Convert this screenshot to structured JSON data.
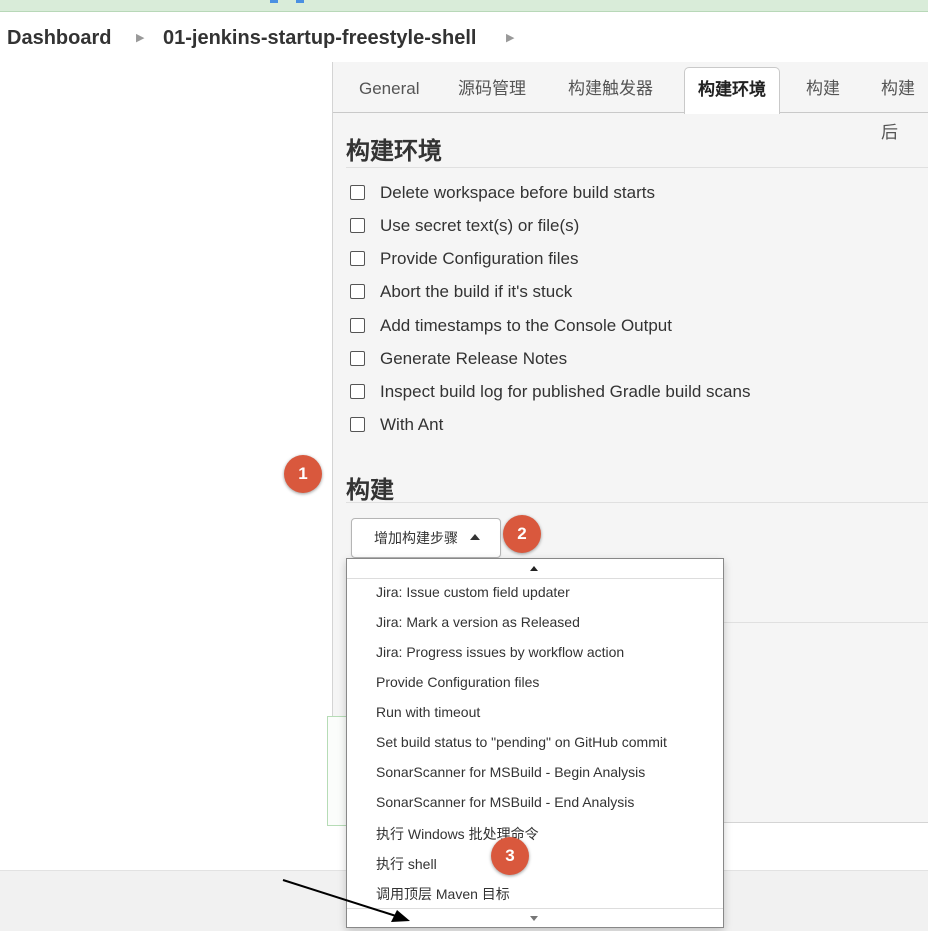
{
  "breadcrumb": {
    "items": [
      "Dashboard",
      "01-jenkins-startup-freestyle-shell"
    ]
  },
  "tabs": [
    {
      "label": "General",
      "active": false
    },
    {
      "label": "源码管理",
      "active": false
    },
    {
      "label": "构建触发器",
      "active": false
    },
    {
      "label": "构建环境",
      "active": true
    },
    {
      "label": "构建",
      "active": false
    },
    {
      "label": "构建后",
      "active": false
    }
  ],
  "build_env": {
    "title": "构建环境",
    "options": [
      "Delete workspace before build starts",
      "Use secret text(s) or file(s)",
      "Provide Configuration files",
      "Abort the build if it's stuck",
      "Add timestamps to the Console Output",
      "Generate Release Notes",
      "Inspect build log for published Gradle build scans",
      "With Ant"
    ]
  },
  "build": {
    "title": "构建",
    "add_step_label": "增加构建步骤"
  },
  "dropdown": {
    "items": [
      "Jira: Issue custom field updater",
      "Jira: Mark a version as Released",
      "Jira: Progress issues by workflow action",
      "Provide Configuration files",
      "Run with timeout",
      "Set build status to \"pending\" on GitHub commit",
      "SonarScanner for MSBuild - Begin Analysis",
      "SonarScanner for MSBuild - End Analysis",
      "执行 Windows 批处理命令",
      "执行 shell",
      "调用顶层 Maven 目标"
    ]
  },
  "annotations": {
    "badges": [
      "1",
      "2",
      "3"
    ],
    "badge_color": "#d9583d"
  }
}
